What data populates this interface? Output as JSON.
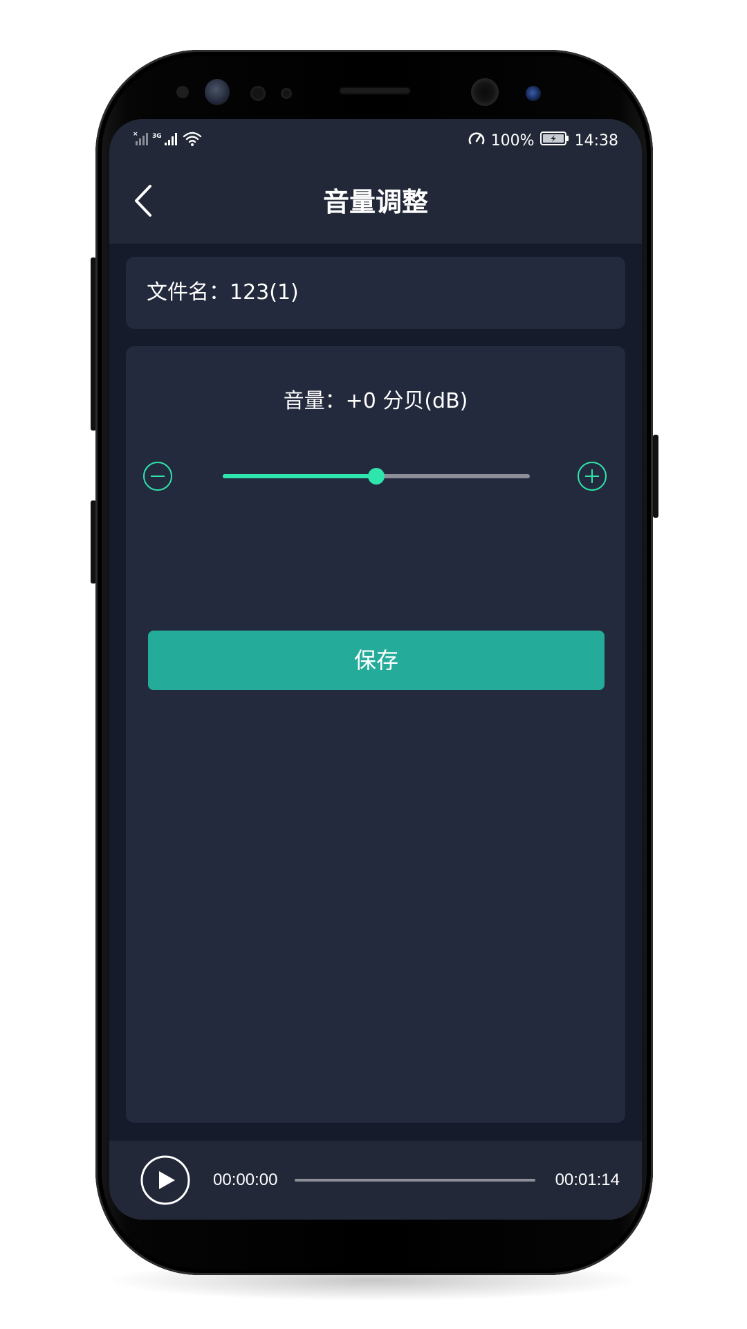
{
  "status_bar": {
    "network_type": "3G",
    "battery_percent": "100%",
    "time": "14:38",
    "icons": [
      "no-sim-signal-icon",
      "signal-icon",
      "wifi-icon",
      "speed-meter-icon",
      "battery-charging-icon"
    ]
  },
  "header": {
    "title": "音量调整",
    "back_icon": "chevron-left-icon"
  },
  "file_info": {
    "label": "文件名：",
    "name": "123(1)"
  },
  "volume": {
    "label": "音量：",
    "value": "+0 分贝(dB)",
    "slider_level": 0.5,
    "decrease_icon": "minus-circle-icon",
    "increase_icon": "plus-circle-icon"
  },
  "actions": {
    "save_label": "保存"
  },
  "player": {
    "current_time": "00:00:00",
    "total_time": "00:01:14",
    "progress": 0,
    "play_icon": "play-icon"
  },
  "colors": {
    "accent": "#2fe5ae",
    "button": "#25ab9a",
    "background": "#151b2b",
    "card": "#242a3d",
    "header": "#222838"
  }
}
